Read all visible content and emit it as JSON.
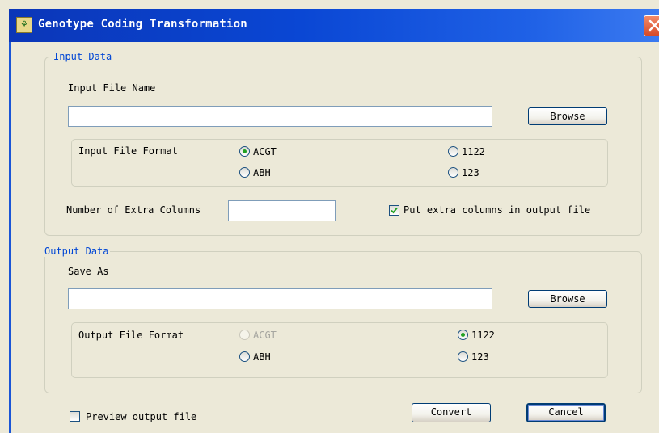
{
  "window": {
    "title": "Genotype Coding Transformation"
  },
  "input_data": {
    "group_label": "Input Data",
    "file_name_label": "Input File Name",
    "file_name_value": "",
    "browse_label": "Browse",
    "format_label": "Input File Format",
    "formats": {
      "acgt": "ACGT",
      "f1122": "1122",
      "abh": "ABH",
      "f123": "123"
    },
    "selected_format": "ACGT",
    "extra_columns_label": "Number of Extra Columns",
    "extra_columns_value": "",
    "put_extra_label": "Put extra columns in output file",
    "put_extra_checked": true
  },
  "output_data": {
    "group_label": "Output Data",
    "save_as_label": "Save As",
    "save_as_value": "",
    "browse_label": "Browse",
    "format_label": "Output File Format",
    "formats": {
      "acgt": "ACGT",
      "f1122": "1122",
      "abh": "ABH",
      "f123": "123"
    },
    "selected_format": "1122",
    "acgt_disabled": true
  },
  "footer": {
    "preview_label": "Preview output file",
    "preview_checked": false,
    "convert_label": "Convert",
    "cancel_label": "Cancel"
  },
  "colors": {
    "title_bar": "#0a47d4",
    "group_label": "#0046d5",
    "radio_dot": "#21a121"
  },
  "icons": {
    "app": "app-logo-icon",
    "close": "close-icon",
    "check": "check-icon"
  }
}
